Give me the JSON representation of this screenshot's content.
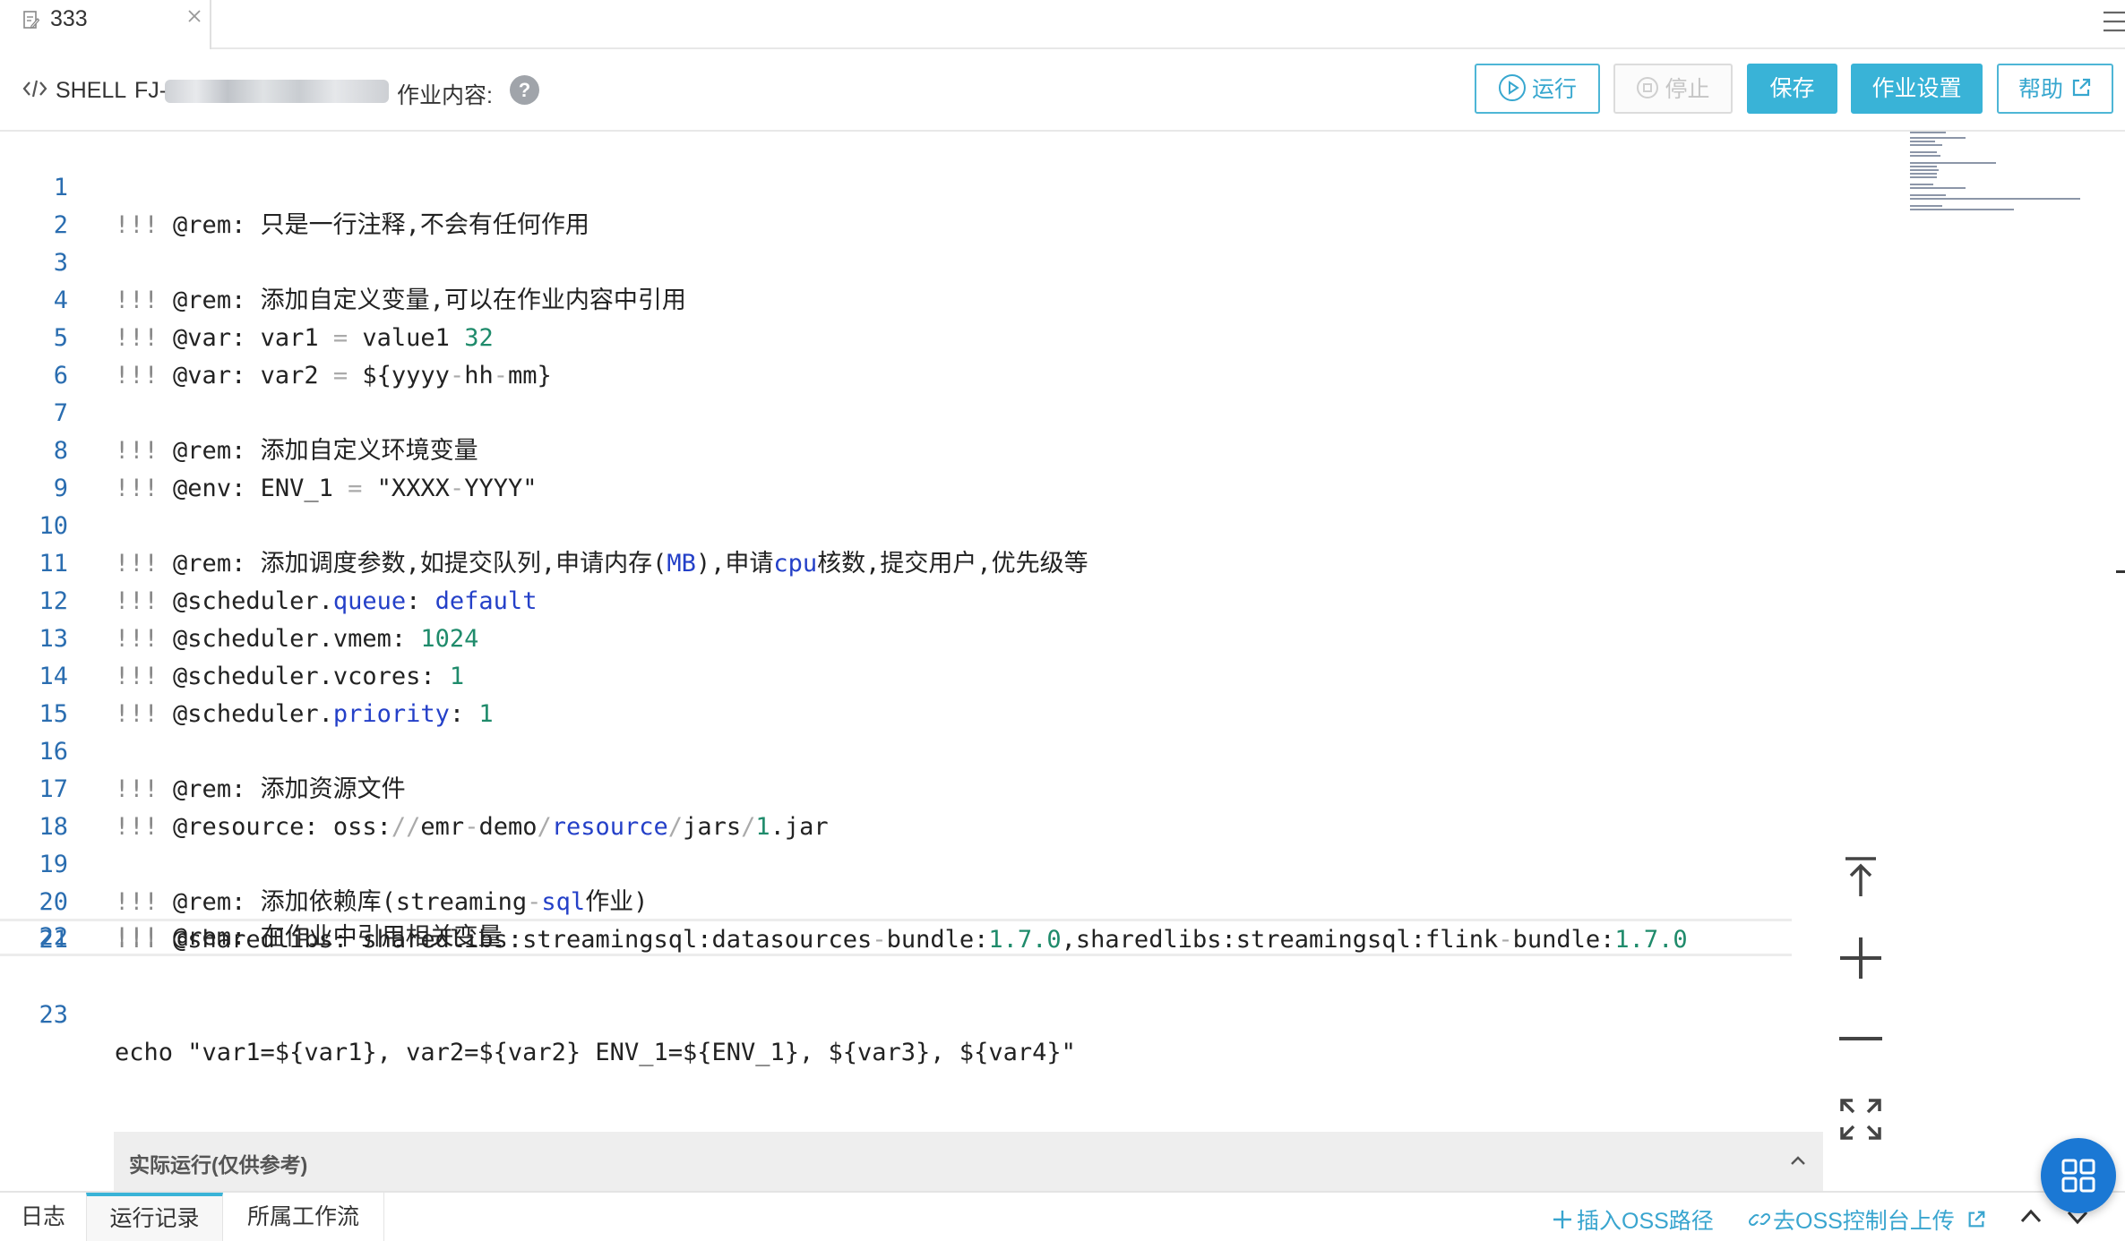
{
  "tab": {
    "title": "333",
    "icon": "edit-icon",
    "close": "close-icon"
  },
  "toolbar": {
    "job_type": "SHELL",
    "job_id_prefix": "FJ-",
    "content_label": "作业内容:",
    "help_symbol": "?",
    "run_label": "运行",
    "stop_label": "停止",
    "save_label": "保存",
    "settings_label": "作业设置",
    "help_label": "帮助"
  },
  "editor": {
    "lines": [
      {
        "n": "1"
      },
      {
        "n": "2"
      },
      {
        "n": "3"
      },
      {
        "n": "4"
      },
      {
        "n": "5"
      },
      {
        "n": "6"
      },
      {
        "n": "7"
      },
      {
        "n": "8"
      },
      {
        "n": "9"
      },
      {
        "n": "10"
      },
      {
        "n": "11"
      },
      {
        "n": "12"
      },
      {
        "n": "13"
      },
      {
        "n": "14"
      },
      {
        "n": "15"
      },
      {
        "n": "16"
      },
      {
        "n": "17"
      },
      {
        "n": "18"
      },
      {
        "n": "19"
      },
      {
        "n": "20"
      },
      {
        "n": "21"
      },
      {
        "n": "22"
      },
      {
        "n": "23"
      }
    ],
    "code": {
      "l1": "@rem: 只是一行注释,不会有任何作用",
      "l3": "@rem: 添加自定义变量,可以在作业内容中引用",
      "l4_a": "@var: var1",
      "l4_b": "value1",
      "l4_c": "32",
      "l5_a": "@var: var2",
      "l5_b": "${yyyy",
      "l5_c": "hh",
      "l5_d": "mm}",
      "l7": "@rem: 添加自定义环境变量",
      "l8_a": "@env: ENV_1",
      "l8_b": "\"XXXX",
      "l8_c": "YYYY\"",
      "l10_a": "@rem: 添加调度参数,如提交队列,申请内存(",
      "l10_b": "MB",
      "l10_c": "),申请",
      "l10_d": "cpu",
      "l10_e": "核数,提交用户,优先级等",
      "l11_a": "@scheduler.",
      "l11_b": "queue",
      "l11_c": ": ",
      "l11_d": "default",
      "l12_a": "@scheduler.vmem: ",
      "l12_b": "1024",
      "l13_a": "@scheduler.vcores: ",
      "l13_b": "1",
      "l14_a": "@scheduler.",
      "l14_b": "priority",
      "l14_c": ": ",
      "l14_d": "1",
      "l16": "@rem: 添加资源文件",
      "l17_a": "@resource: oss:",
      "l17_b": "emr",
      "l17_c": "demo",
      "l17_d": "resource",
      "l17_e": "jars",
      "l17_f": "1",
      "l17_g": ".jar",
      "l19_a": "@rem: 添加依赖库(streaming",
      "l19_b": "sql",
      "l19_c": "作业)",
      "l20_a": "@sharedlibs: sharedlibs:streamingsql:datasources",
      "l20_b": "bundle:",
      "l20_c": "1.7.0",
      "l20_d": ",sharedlibs:streamingsql:flink",
      "l20_e": "bundle:",
      "l20_f": "1.7.0",
      "l22": "@rem: 在作业中引用相关变量",
      "l23": "echo \"var1=${var1}, var2=${var2} ENV_1=${ENV_1}, ${var3}, ${var4}\"",
      "bang": "!!!"
    }
  },
  "run_panel": {
    "title": "实际运行(仅供参考)"
  },
  "bottom": {
    "tab_log": "日志",
    "tab_runs": "运行记录",
    "tab_flow": "所属工作流",
    "insert_oss": "插入OSS路径",
    "oss_console": "去OSS控制台上传"
  },
  "colors": {
    "accent": "#39b3d7",
    "line_number": "#2a6db0",
    "keyword": "#2440c8",
    "number": "#1f8b6b",
    "fab": "#1b78d4"
  }
}
